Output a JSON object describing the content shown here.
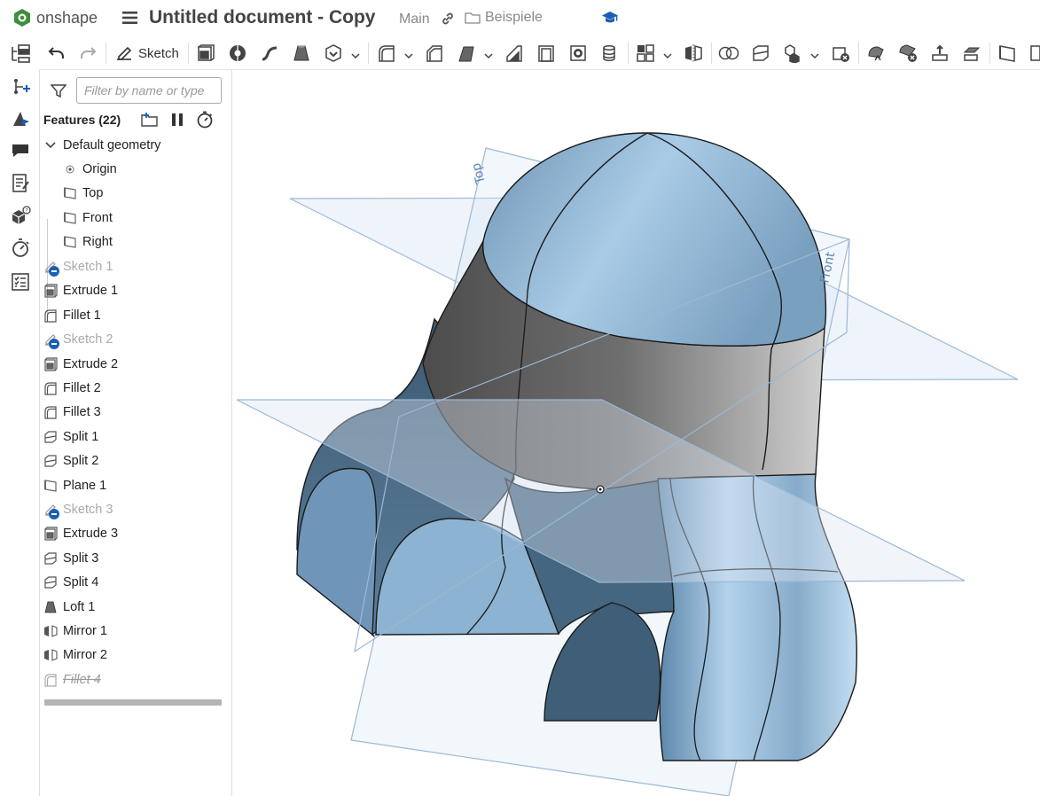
{
  "app": {
    "logo_text": "onshape",
    "document_title": "Untitled document - Copy",
    "branch": "Main",
    "folder": "Beispiele"
  },
  "toolbar": {
    "sketch_label": "Sketch",
    "tools": [
      "undo-icon",
      "redo-icon",
      "sketch",
      "extrude-icon",
      "revolve-icon",
      "sweep-icon",
      "loft-icon",
      "thicken-icon",
      "fillet-icon",
      "chamfer-icon",
      "draft-icon",
      "rib-icon",
      "shell-icon",
      "hole-icon",
      "cylinder-icon",
      "pattern-icon",
      "mirror-icon",
      "boolean-icon",
      "split-icon",
      "transform-icon",
      "delete-part-icon",
      "modify-fillet-icon",
      "delete-face-icon",
      "move-face-icon",
      "replace-face-icon",
      "plane-icon",
      "more-icon"
    ]
  },
  "leftrail": {
    "items": [
      "feature-list-icon",
      "insert-mate-connector-icon",
      "appearance-icon",
      "comments-icon",
      "notes-icon",
      "configurations-icon",
      "measure-icon",
      "checklist-icon"
    ]
  },
  "features": {
    "filter_placeholder": "Filter by name or type",
    "header": "Features (22)",
    "default_geometry": {
      "label": "Default geometry",
      "children": [
        "Origin",
        "Top",
        "Front",
        "Right"
      ]
    },
    "items": [
      {
        "label": "Sketch 1",
        "type": "sketch",
        "state": "suppressed"
      },
      {
        "label": "Extrude 1",
        "type": "extrude",
        "state": "normal"
      },
      {
        "label": "Fillet 1",
        "type": "fillet",
        "state": "normal"
      },
      {
        "label": "Sketch 2",
        "type": "sketch",
        "state": "suppressed"
      },
      {
        "label": "Extrude 2",
        "type": "extrude",
        "state": "normal"
      },
      {
        "label": "Fillet 2",
        "type": "fillet",
        "state": "normal"
      },
      {
        "label": "Fillet 3",
        "type": "fillet",
        "state": "normal"
      },
      {
        "label": "Split 1",
        "type": "split",
        "state": "normal"
      },
      {
        "label": "Split 2",
        "type": "split",
        "state": "normal"
      },
      {
        "label": "Plane 1",
        "type": "plane",
        "state": "normal"
      },
      {
        "label": "Sketch 3",
        "type": "sketch",
        "state": "suppressed"
      },
      {
        "label": "Extrude 3",
        "type": "extrude",
        "state": "normal"
      },
      {
        "label": "Split 3",
        "type": "split",
        "state": "normal"
      },
      {
        "label": "Split 4",
        "type": "split",
        "state": "normal"
      },
      {
        "label": "Loft 1",
        "type": "loft",
        "state": "normal"
      },
      {
        "label": "Mirror 1",
        "type": "mirror",
        "state": "normal"
      },
      {
        "label": "Mirror 2",
        "type": "mirror",
        "state": "normal"
      },
      {
        "label": "Fillet 4",
        "type": "fillet",
        "state": "rolled"
      }
    ]
  },
  "viewport": {
    "plane_labels": {
      "top": "Top",
      "front": "Front"
    }
  },
  "colors": {
    "accent": "#1a5fb4",
    "part_blue": "#8fb6d4",
    "part_dark": "#4e6b82",
    "part_grey": "#6f6f6f",
    "plane_fill": "#d9e6f3",
    "plane_edge": "#9bb8d6"
  }
}
